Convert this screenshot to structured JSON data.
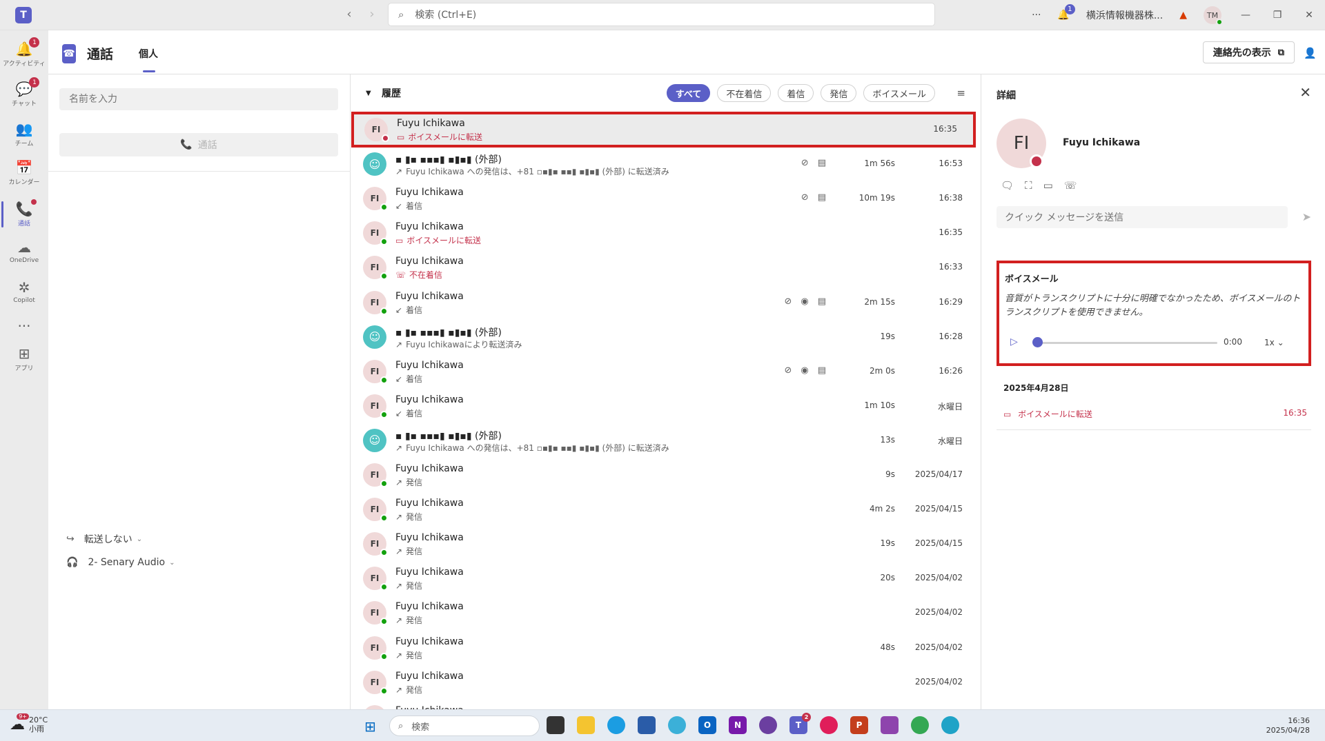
{
  "titlebar": {
    "app_logo": "T",
    "search_placeholder": "検索 (Ctrl+E)",
    "more": "···",
    "notif_count": "1",
    "org_name": "横浜情報機器株...",
    "warning": "▲",
    "user_initials": "TM",
    "min": "—",
    "restore": "❐",
    "close": "✕"
  },
  "rail": [
    {
      "icon": "bell-icon",
      "glyph": "🔔",
      "label": "アクティビティ",
      "badge": "1"
    },
    {
      "icon": "chat-icon",
      "glyph": "💬",
      "label": "チャット",
      "badge": "1"
    },
    {
      "icon": "teams-icon",
      "glyph": "👥",
      "label": "チーム"
    },
    {
      "icon": "calendar-icon",
      "glyph": "📅",
      "label": "カレンダー"
    },
    {
      "icon": "phone-icon",
      "glyph": "📞",
      "label": "通話",
      "active": true,
      "dot": true
    },
    {
      "icon": "onedrive-icon",
      "glyph": "☁",
      "label": "OneDrive"
    },
    {
      "icon": "copilot-icon",
      "glyph": "✲",
      "label": "Copilot"
    },
    {
      "icon": "more-icon",
      "glyph": "···",
      "label": ""
    },
    {
      "icon": "apps-icon",
      "glyph": "⊞",
      "label": "アプリ"
    }
  ],
  "header": {
    "title": "通話",
    "tab": "個人",
    "contacts_button": "連絡先の表示"
  },
  "left": {
    "name_placeholder": "名前を入力",
    "call_button": "通話",
    "forward": "転送しない",
    "audio": "2- Senary Audio"
  },
  "history": {
    "title": "履歴",
    "filters": [
      "すべて",
      "不在着信",
      "着信",
      "発信",
      "ボイスメール"
    ],
    "rows": [
      {
        "initials": "FI",
        "name": "Fuyu Ichikawa",
        "sub": "ボイスメールに転送",
        "sub_icon": "▭",
        "sub_red": true,
        "status": "red",
        "icons": [],
        "dur": "",
        "time": "16:35",
        "selected": true
      },
      {
        "initials": "",
        "external": true,
        "name": "▪ ▮▪ ▪▪▪▮ ▪▮▪▮ (外部)",
        "sub": "Fuyu Ichikawa への発信は、+81 ▫▪▮▪ ▪▪▮ ▪▮▪▮ (外部) に転送済み",
        "sub_icon": "↗",
        "icons": [
          "copilot",
          "note"
        ],
        "dur": "1m 56s",
        "time": "16:53"
      },
      {
        "initials": "FI",
        "name": "Fuyu Ichikawa",
        "sub": "着信",
        "sub_icon": "↙",
        "status": "green",
        "icons": [
          "copilot",
          "note"
        ],
        "dur": "10m 19s",
        "time": "16:38"
      },
      {
        "initials": "FI",
        "name": "Fuyu Ichikawa",
        "sub": "ボイスメールに転送",
        "sub_icon": "▭",
        "sub_red": true,
        "status": "green",
        "icons": [],
        "dur": "",
        "time": "16:35"
      },
      {
        "initials": "FI",
        "name": "Fuyu Ichikawa",
        "sub": "不在着信",
        "sub_icon": "☏",
        "sub_red": true,
        "status": "green",
        "icons": [],
        "dur": "",
        "time": "16:33"
      },
      {
        "initials": "FI",
        "name": "Fuyu Ichikawa",
        "sub": "着信",
        "sub_icon": "↙",
        "status": "green",
        "icons": [
          "copilot",
          "record",
          "note"
        ],
        "dur": "2m 15s",
        "time": "16:29"
      },
      {
        "initials": "",
        "external": true,
        "name": "▪ ▮▪ ▪▪▪▮ ▪▮▪▮ (外部)",
        "sub": "Fuyu Ichikawaにより転送済み",
        "sub_icon": "↗",
        "icons": [],
        "dur": "19s",
        "time": "16:28"
      },
      {
        "initials": "FI",
        "name": "Fuyu Ichikawa",
        "sub": "着信",
        "sub_icon": "↙",
        "status": "green",
        "icons": [
          "copilot",
          "record",
          "note"
        ],
        "dur": "2m 0s",
        "time": "16:26"
      },
      {
        "initials": "FI",
        "name": "Fuyu Ichikawa",
        "sub": "着信",
        "sub_icon": "↙",
        "status": "green",
        "icons": [],
        "dur": "1m 10s",
        "time": "水曜日"
      },
      {
        "initials": "",
        "external": true,
        "name": "▪ ▮▪ ▪▪▪▮ ▪▮▪▮ (外部)",
        "sub": "Fuyu Ichikawa への発信は、+81 ▫▪▮▪ ▪▪▮ ▪▮▪▮ (外部) に転送済み",
        "sub_icon": "↗",
        "icons": [],
        "dur": "13s",
        "time": "水曜日"
      },
      {
        "initials": "FI",
        "name": "Fuyu Ichikawa",
        "sub": "発信",
        "sub_icon": "↗",
        "status": "green",
        "icons": [],
        "dur": "9s",
        "time": "2025/04/17"
      },
      {
        "initials": "FI",
        "name": "Fuyu Ichikawa",
        "sub": "発信",
        "sub_icon": "↗",
        "status": "green",
        "icons": [],
        "dur": "4m 2s",
        "time": "2025/04/15"
      },
      {
        "initials": "FI",
        "name": "Fuyu Ichikawa",
        "sub": "発信",
        "sub_icon": "↗",
        "status": "green",
        "icons": [],
        "dur": "19s",
        "time": "2025/04/15"
      },
      {
        "initials": "FI",
        "name": "Fuyu Ichikawa",
        "sub": "発信",
        "sub_icon": "↗",
        "status": "green",
        "icons": [],
        "dur": "20s",
        "time": "2025/04/02"
      },
      {
        "initials": "FI",
        "name": "Fuyu Ichikawa",
        "sub": "発信",
        "sub_icon": "↗",
        "status": "green",
        "icons": [],
        "dur": "",
        "time": "2025/04/02"
      },
      {
        "initials": "FI",
        "name": "Fuyu Ichikawa",
        "sub": "発信",
        "sub_icon": "↗",
        "status": "green",
        "icons": [],
        "dur": "48s",
        "time": "2025/04/02"
      },
      {
        "initials": "FI",
        "name": "Fuyu Ichikawa",
        "sub": "発信",
        "sub_icon": "↗",
        "status": "green",
        "icons": [],
        "dur": "",
        "time": "2025/04/02"
      },
      {
        "initials": "FI",
        "name": "Fuyu Ichikawa",
        "sub": "",
        "sub_icon": "",
        "status": "green",
        "icons": [],
        "dur": "",
        "time": ""
      }
    ]
  },
  "details": {
    "title": "詳細",
    "initials": "FI",
    "name": "Fuyu Ichikawa",
    "quick_message_placeholder": "クイック メッセージを送信",
    "voicemail_title": "ボイスメール",
    "voicemail_text": "音質がトランスクリプトに十分に明確でなかったため、ボイスメールのトランスクリプトを使用できません。",
    "playback_time": "0:00",
    "speed": "1x",
    "date": "2025年4月28日",
    "entry_label": "ボイスメールに転送",
    "entry_time": "16:35"
  },
  "taskbar": {
    "weather_badge": "9+",
    "temp": "20°C",
    "weather": "小雨",
    "search": "検索",
    "teams_badge": "2",
    "time": "16:36",
    "date": "2025/04/28"
  },
  "colors": {
    "accent": "#5b5fc7",
    "highlight_box": "#d21f1f",
    "missed": "#c4314b",
    "online": "#13a10e"
  }
}
